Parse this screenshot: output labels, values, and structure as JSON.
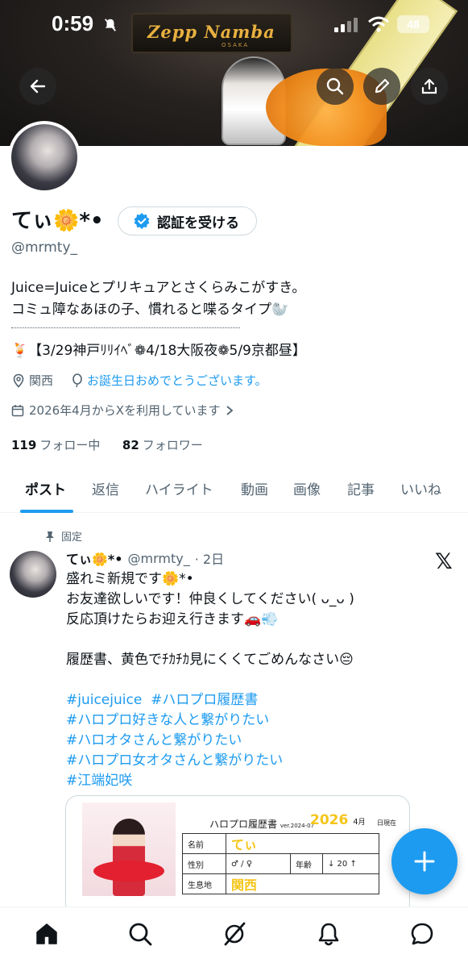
{
  "status_bar": {
    "time": "0:59",
    "battery": "48"
  },
  "banner": {
    "venue_text": "Zepp Namba",
    "venue_sub": "OSAKA"
  },
  "profile": {
    "display_name": "てぃ🌼*•",
    "verify_button": "認証を受ける",
    "handle": "@mrmty_",
    "bio_line1": "Juice=Juiceとプリキュアとさくらみこがすき。",
    "bio_line2": "コミュ障なあほの子、慣れると喋るタイプ🦭",
    "bio_line3": "🍹【3/29神戸ﾘﾘｲﾍﾞ❁4/18大阪夜❁5/9京都昼】",
    "location": "関西",
    "birthday": "お誕生日おめでとうございます。",
    "joined": "2026年4月からXを利用しています",
    "following_count": "119",
    "following_label": "フォロー中",
    "followers_count": "82",
    "followers_label": "フォロワー"
  },
  "tabs": [
    "ポスト",
    "返信",
    "ハイライト",
    "動画",
    "画像",
    "記事",
    "いいね"
  ],
  "active_tab": "ポスト",
  "post": {
    "pinned_label": "固定",
    "name": "てぃ🌼*•",
    "handle": "@mrmty_",
    "time": "· 2日",
    "text_lines": [
      "盛れミ新規です🌼*•",
      "お友達欲しいです！仲良くしてください( ᴗ_ᴗ )",
      "反応頂けたらお迎え行きます🚗💨",
      "",
      "履歴書、黄色でﾁｶﾁｶ見にくくてごめんなさい😔"
    ],
    "hashtags": [
      "#juicejuice  #ハロプロ履歴書",
      "#ハロプロ好きな人と繋がりたい",
      "#ハロオタさんと繋がりたい",
      "#ハロプロ女オタさんと繋がりたい",
      "#江端妃咲"
    ],
    "card": {
      "sheet_title": "ハロプロ履歴書",
      "sheet_version": "ver.2024-07",
      "sheet_year": "2026",
      "sheet_month": "4",
      "sheet_month_unit": "月",
      "sheet_date_label": "日現在",
      "row_name_label": "名前",
      "row_name_value": "てぃ",
      "row_gender_label": "性別",
      "row_gender_value": "♂ / ♀",
      "row_age_label": "年齢",
      "row_age_value": "↓ 20 ↑",
      "row_home_label": "生息地",
      "row_home_value": "関西"
    }
  },
  "colors": {
    "accent": "#1d9bf0",
    "text": "#0f1419",
    "muted": "#536471",
    "border": "#cfd9de"
  },
  "icons": {
    "header": [
      "back-arrow-icon",
      "search-icon",
      "edit-pencil-icon",
      "share-icon"
    ],
    "bottom_nav": [
      "home-icon",
      "search-icon",
      "grok-icon",
      "notifications-bell-icon",
      "messages-icon"
    ]
  }
}
